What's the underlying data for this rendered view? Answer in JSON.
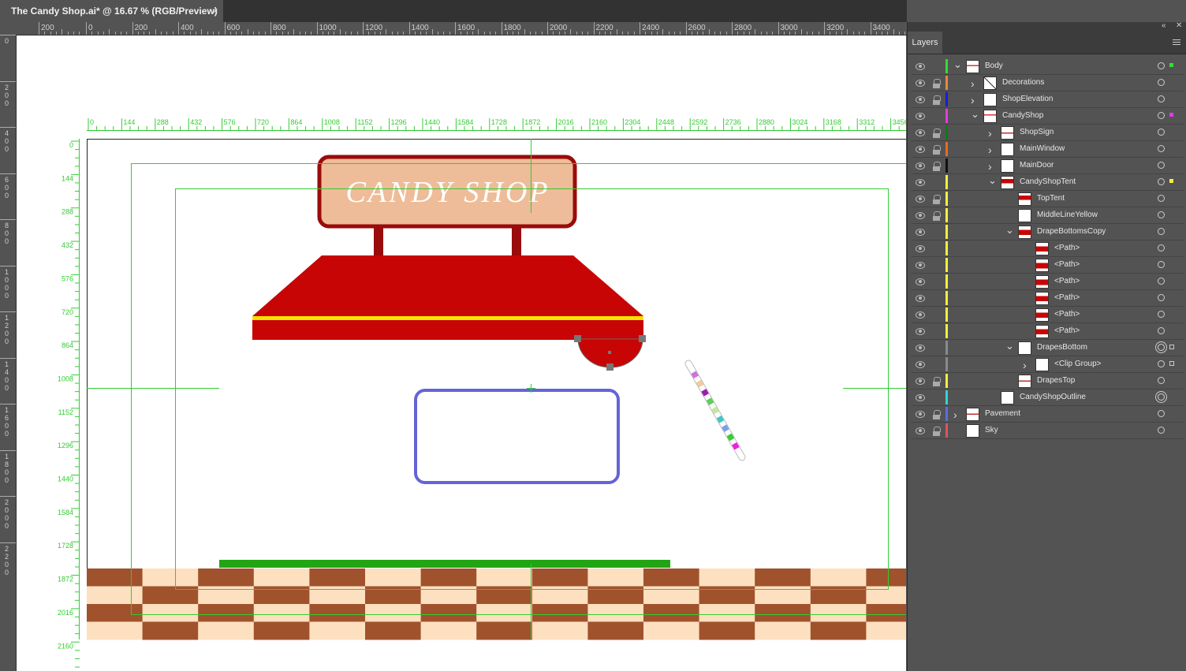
{
  "document": {
    "tab_title": "The Candy Shop.ai* @ 16.67 % (RGB/Preview)",
    "close_glyph": "×"
  },
  "top_ruler_labels": [
    "200",
    "0",
    "200",
    "400",
    "600",
    "800",
    "1000",
    "1200",
    "1400",
    "1600",
    "1800",
    "2000",
    "2200",
    "2400",
    "2600",
    "2800",
    "3000",
    "3200",
    "3400"
  ],
  "left_ruler_labels": [
    "0",
    "200",
    "400",
    "600",
    "800",
    "1000",
    "1200",
    "1400",
    "1600",
    "1800",
    "2000",
    "2200"
  ],
  "artboard_ruler_top": [
    "0",
    "144",
    "288",
    "432",
    "576",
    "720",
    "864",
    "1008",
    "1152",
    "1296",
    "1440",
    "1584",
    "1728",
    "1872",
    "2016",
    "2160",
    "2304",
    "2448",
    "2592",
    "2736",
    "2880",
    "3024",
    "3168",
    "3312",
    "3456"
  ],
  "artboard_ruler_left": [
    "0",
    "144",
    "288",
    "432",
    "576",
    "720",
    "864",
    "1008",
    "1152",
    "1296",
    "1440",
    "1584",
    "1728",
    "1872",
    "2016",
    "2160"
  ],
  "artwork": {
    "sign_text": "CANDY SHOP",
    "colors": {
      "sign_border": "#9a0b0b",
      "sign_fill": "#eebc98",
      "tent": "#c80505",
      "tent_stripe": "#f3e300",
      "window_stroke": "#6464d8",
      "grass": "#22a513",
      "pavement_dark": "#a0522d",
      "pavement_light": "#fde0bf",
      "guides": "#33cc33"
    }
  },
  "layers_panel": {
    "tab_label": "Layers",
    "collapse_icon": "double-chevron-left-icon",
    "close_icon": "close-icon",
    "menu_icon": "hamburger-menu-icon",
    "rows": [
      {
        "name": "Body",
        "depth": 0,
        "expand": "open",
        "locked": false,
        "color": "#33dd33"
      },
      {
        "name": "Decorations",
        "depth": 1,
        "expand": "closed",
        "locked": true,
        "color": "#e38b3a"
      },
      {
        "name": "ShopElevation",
        "depth": 1,
        "expand": "closed",
        "locked": true,
        "color": "#1a1adb"
      },
      {
        "name": "CandyShop",
        "depth": 1,
        "expand": "open",
        "locked": false,
        "color": "#e23be2"
      },
      {
        "name": "ShopSign",
        "depth": 2,
        "expand": "closed",
        "locked": true,
        "color": "#0c7a18"
      },
      {
        "name": "MainWindow",
        "depth": 2,
        "expand": "closed",
        "locked": true,
        "color": "#e66d1d"
      },
      {
        "name": "MainDoor",
        "depth": 2,
        "expand": "closed",
        "locked": true,
        "color": "#111111"
      },
      {
        "name": "CandyShopTent",
        "depth": 2,
        "expand": "open",
        "locked": false,
        "color": "#f6ef3b"
      },
      {
        "name": "TopTent",
        "depth": 3,
        "expand": "none",
        "locked": true,
        "color": "#f6ef3b"
      },
      {
        "name": "MiddleLineYellow",
        "depth": 3,
        "expand": "none",
        "locked": true,
        "color": "#f6ef3b"
      },
      {
        "name": "DrapeBottomsCopy",
        "depth": 3,
        "expand": "open",
        "locked": false,
        "color": "#f6ef3b"
      },
      {
        "name": "<Path>",
        "depth": 4,
        "expand": "none",
        "locked": false,
        "color": "#f6ef3b"
      },
      {
        "name": "<Path>",
        "depth": 4,
        "expand": "none",
        "locked": false,
        "color": "#f6ef3b"
      },
      {
        "name": "<Path>",
        "depth": 4,
        "expand": "none",
        "locked": false,
        "color": "#f6ef3b"
      },
      {
        "name": "<Path>",
        "depth": 4,
        "expand": "none",
        "locked": false,
        "color": "#f6ef3b"
      },
      {
        "name": "<Path>",
        "depth": 4,
        "expand": "none",
        "locked": false,
        "color": "#f6ef3b"
      },
      {
        "name": "<Path>",
        "depth": 4,
        "expand": "none",
        "locked": false,
        "color": "#f6ef3b"
      },
      {
        "name": "DrapesBottom",
        "depth": 3,
        "expand": "open",
        "locked": false,
        "color": "#8a8a8a"
      },
      {
        "name": "<Clip Group>",
        "depth": 4,
        "expand": "closed",
        "locked": false,
        "color": "#8a8a8a"
      },
      {
        "name": "DrapesTop",
        "depth": 3,
        "expand": "none",
        "locked": true,
        "color": "#f6ef3b"
      },
      {
        "name": "CandyShopOutline",
        "depth": 2,
        "expand": "none",
        "locked": false,
        "color": "#33d4d4"
      },
      {
        "name": "Pavement",
        "depth": 0,
        "expand": "closed",
        "locked": true,
        "color": "#5a6ee0"
      },
      {
        "name": "Sky",
        "depth": 0,
        "expand": "none",
        "locked": true,
        "color": "#e05555"
      }
    ]
  }
}
